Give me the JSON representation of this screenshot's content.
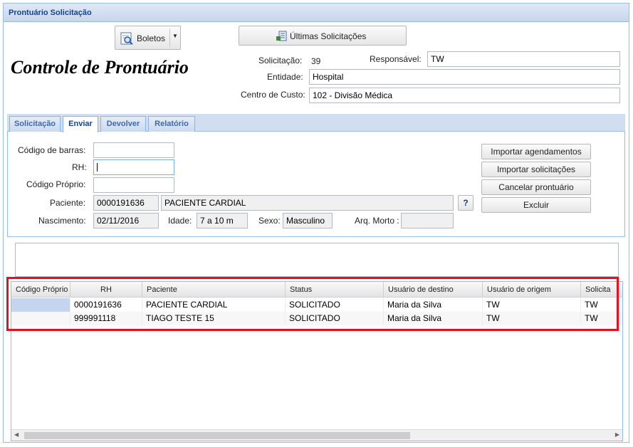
{
  "window": {
    "title": "Prontuário Solicitação"
  },
  "toolbar": {
    "boletos_label": "Boletos",
    "ultimas_label": "Últimas Solicitações"
  },
  "heading": "Controle de Prontuário",
  "request": {
    "solicitacao_label": "Solicitação:",
    "solicitacao_value": "39",
    "responsavel_label": "Responsável:",
    "responsavel_value": "TW",
    "entidade_label": "Entidade:",
    "entidade_value": "Hospital",
    "centro_label": "Centro de Custo:",
    "centro_value": "102 - Divisão Médica"
  },
  "tabs": [
    {
      "label": "Solicitação"
    },
    {
      "label": "Enviar"
    },
    {
      "label": "Devolver"
    },
    {
      "label": "Relatório"
    }
  ],
  "form": {
    "codigo_barras_label": "Código de barras:",
    "codigo_barras_value": "",
    "rh_label": "RH:",
    "rh_value": "",
    "codigo_proprio_label": "Código Próprio:",
    "codigo_proprio_value": "",
    "paciente_label": "Paciente:",
    "paciente_id": "0000191636",
    "paciente_nome": "PACIENTE CARDIAL",
    "help_label": "?",
    "nascimento_label": "Nascimento:",
    "nascimento_value": "02/11/2016",
    "idade_label": "Idade:",
    "idade_value": "7 a 10 m",
    "sexo_label": "Sexo:",
    "sexo_value": "Masculino",
    "arq_morto_label": "Arq. Morto :",
    "arq_morto_value": ""
  },
  "actions": {
    "importar_agendamentos": "Importar agendamentos",
    "importar_solicitacoes": "Importar solicitações",
    "cancelar_prontuario": "Cancelar prontuário",
    "excluir": "Excluir"
  },
  "grid": {
    "columns": [
      "Código Próprio",
      "RH",
      "Paciente",
      "Status",
      "Usuário de destino",
      "Usuário de origem",
      "Solicita"
    ],
    "rows": [
      [
        "",
        "0000191636",
        "PACIENTE CARDIAL",
        "SOLICITADO",
        "Maria da Silva",
        "TW",
        "TW"
      ],
      [
        "",
        "999991118",
        "TIAGO TESTE 15",
        "SOLICITADO",
        "Maria da Silva",
        "TW",
        "TW"
      ]
    ]
  },
  "colors": {
    "title_text": "#15428b",
    "highlight_box": "#e0131f",
    "selected_cell": "#c5d5ef"
  }
}
